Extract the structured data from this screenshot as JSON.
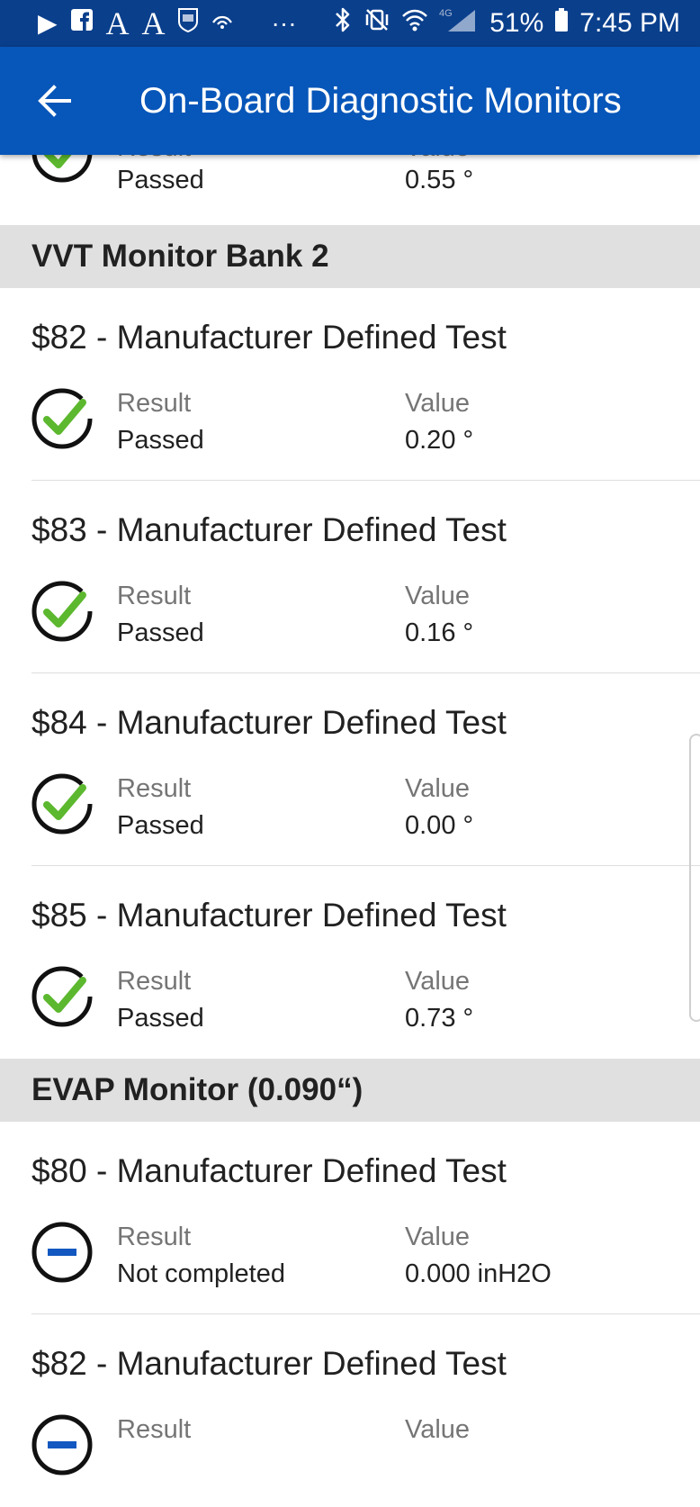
{
  "status_bar": {
    "left_icons": [
      "play-store-icon",
      "facebook-icon",
      "font-a-icon",
      "font-a-icon",
      "nfl-icon",
      "wireless-icon",
      "more-dots-icon"
    ],
    "battery": "51%",
    "time": "7:45 PM"
  },
  "app_bar": {
    "title": "On-Board Diagnostic Monitors",
    "back_icon": "arrow-back-icon"
  },
  "colors": {
    "app_bar": "#0756b9",
    "status_bar": "#0a3f8c",
    "passed_check": "#5cb82e",
    "not_completed": "#1258c0"
  },
  "top_partial_item": {
    "result_label": "Result",
    "value_label": "Value",
    "result": "Passed",
    "value": "0.55 °"
  },
  "sections": [
    {
      "title": "VVT Monitor Bank 2",
      "items": [
        {
          "title": "$82 - Manufacturer Defined Test",
          "status": "passed",
          "result_label": "Result",
          "result": "Passed",
          "value_label": "Value",
          "value": "0.20 °"
        },
        {
          "title": "$83 - Manufacturer Defined Test",
          "status": "passed",
          "result_label": "Result",
          "result": "Passed",
          "value_label": "Value",
          "value": "0.16 °"
        },
        {
          "title": "$84 - Manufacturer Defined Test",
          "status": "passed",
          "result_label": "Result",
          "result": "Passed",
          "value_label": "Value",
          "value": "0.00 °"
        },
        {
          "title": "$85 - Manufacturer Defined Test",
          "status": "passed",
          "result_label": "Result",
          "result": "Passed",
          "value_label": "Value",
          "value": "0.73 °"
        }
      ]
    },
    {
      "title": "EVAP Monitor (0.090“)",
      "items": [
        {
          "title": "$80 - Manufacturer Defined Test",
          "status": "not-completed",
          "result_label": "Result",
          "result": "Not completed",
          "value_label": "Value",
          "value": "0.000 inH2O"
        },
        {
          "title": "$82 - Manufacturer Defined Test",
          "status": "not-completed",
          "result_label": "Result",
          "value_label": "Value"
        }
      ]
    }
  ]
}
